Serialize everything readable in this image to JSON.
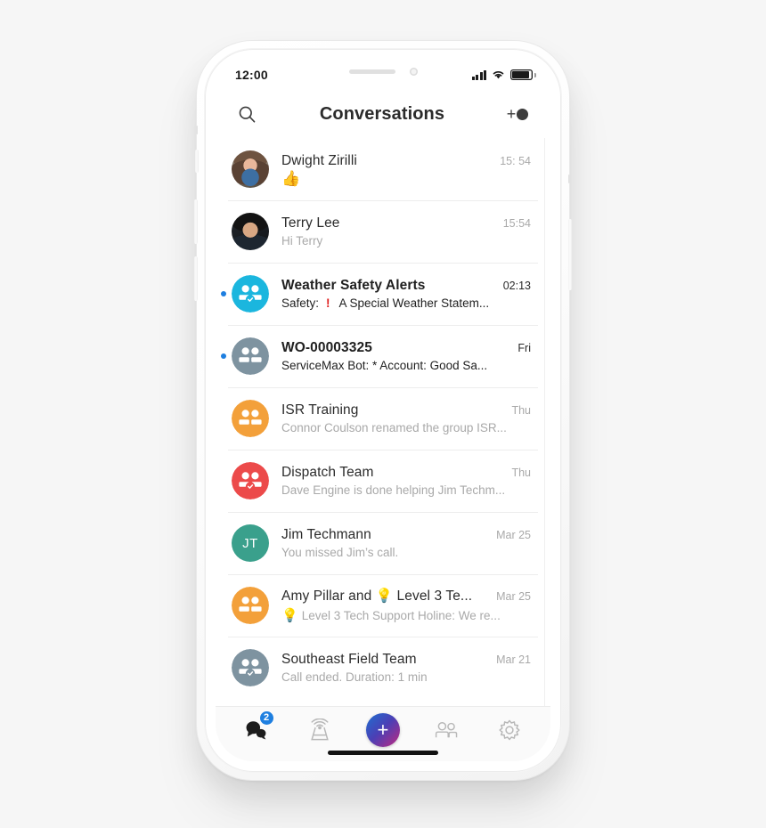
{
  "status_bar": {
    "time": "12:00",
    "signal_icon": "cellular-signal-icon",
    "wifi_icon": "wifi-icon",
    "battery_icon": "battery-icon"
  },
  "header": {
    "title": "Conversations",
    "search_icon": "search-icon",
    "add_icon": "add-contact-icon"
  },
  "colors": {
    "accent_blue": "#1e7fe0",
    "unread_dot": "#1e7fe0",
    "alert_red": "#e02020",
    "avatar_cyan": "#1bb6de",
    "avatar_slate": "#7e93a0",
    "avatar_orange": "#f3a03a",
    "avatar_red": "#ec4a4a",
    "avatar_teal": "#3aa08c",
    "fab_gradient_start": "#1f6fd0",
    "fab_gradient_end": "#c0297f",
    "page_background": "#f6f6f6"
  },
  "conversations": [
    {
      "name": "Dwight Zirilli",
      "time": "15: 54",
      "preview": "",
      "preview_emoji": "👍",
      "avatar_type": "photo-dwight",
      "avatar_color": "",
      "initials": "",
      "unread": false,
      "has_alert": false
    },
    {
      "name": "Terry Lee",
      "time": "15:54",
      "preview": "Hi Terry",
      "preview_emoji": "",
      "avatar_type": "photo-terry",
      "avatar_color": "",
      "initials": "",
      "unread": false,
      "has_alert": false
    },
    {
      "name": "Weather Safety Alerts",
      "time": "02:13",
      "preview_prefix": "Safety:",
      "preview": "A Special Weather Statem...",
      "preview_emoji": "",
      "avatar_type": "group-verified",
      "avatar_color": "#1bb6de",
      "initials": "",
      "unread": true,
      "has_alert": true
    },
    {
      "name": "WO-00003325",
      "time": "Fri",
      "preview": "ServiceMax Bot: * Account: Good Sa...",
      "preview_emoji": "",
      "avatar_type": "group",
      "avatar_color": "#7e93a0",
      "initials": "",
      "unread": true,
      "has_alert": false
    },
    {
      "name": "ISR Training",
      "time": "Thu",
      "preview": "Connor Coulson renamed the group ISR...",
      "preview_emoji": "",
      "avatar_type": "group",
      "avatar_color": "#f3a03a",
      "initials": "",
      "unread": false,
      "has_alert": false
    },
    {
      "name": "Dispatch Team",
      "time": "Thu",
      "preview": "Dave Engine is done helping Jim Techm...",
      "preview_emoji": "",
      "avatar_type": "group-verified",
      "avatar_color": "#ec4a4a",
      "initials": "",
      "unread": false,
      "has_alert": false
    },
    {
      "name": "Jim Techmann",
      "time": "Mar 25",
      "preview": "You missed Jim’s call.",
      "preview_emoji": "",
      "avatar_type": "initials",
      "avatar_color": "#3aa08c",
      "initials": "JT",
      "unread": false,
      "has_alert": false
    },
    {
      "name": "Amy Pillar and 💡 Level 3 Te...",
      "time": "Mar 25",
      "preview": "Level 3 Tech Support Holine: We re...",
      "preview_emoji": "💡",
      "avatar_type": "group",
      "avatar_color": "#f3a03a",
      "initials": "",
      "unread": false,
      "has_alert": false
    },
    {
      "name": "Southeast Field Team",
      "time": "Mar 21",
      "preview": "Call ended. Duration: 1 min",
      "preview_emoji": "",
      "avatar_type": "group-verified",
      "avatar_color": "#7e93a0",
      "initials": "",
      "unread": false,
      "has_alert": false
    }
  ],
  "tab_bar": {
    "items": [
      {
        "icon": "chat-bubbles-icon",
        "badge": "2",
        "active": true
      },
      {
        "icon": "broadcast-tower-icon",
        "badge": "",
        "active": false
      },
      {
        "icon": "plus-icon",
        "badge": "",
        "active": false
      },
      {
        "icon": "contacts-icon",
        "badge": "",
        "active": false
      },
      {
        "icon": "gear-icon",
        "badge": "",
        "active": false
      }
    ],
    "fab_label": "+"
  }
}
